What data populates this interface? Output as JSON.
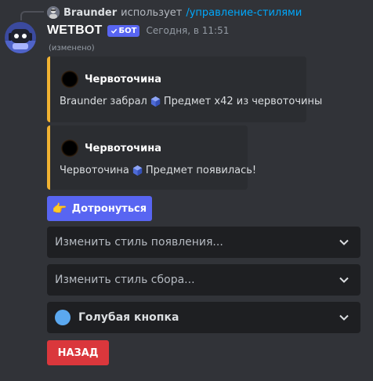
{
  "reply": {
    "author": "Braunder",
    "action": "использует",
    "command": "/управление-стилями"
  },
  "message": {
    "username": "WETBOT",
    "bot_tag": "БОТ",
    "timestamp": "Сегодня, в 11:51",
    "edited": "(изменено)"
  },
  "embeds": [
    {
      "author": "Червоточина",
      "desc_prefix": "Braunder забрал",
      "desc_suffix": "Предмет x42 из червоточины",
      "accent": "#f0b232"
    },
    {
      "author": "Червоточина",
      "desc_prefix": "Червоточина",
      "desc_suffix": "Предмет появилась!",
      "accent": "#f0b232"
    }
  ],
  "buttons": {
    "touch_label": "Дотронуться",
    "touch_icon": "pointing-hand-emoji",
    "back_label": "НАЗАД"
  },
  "selects": [
    {
      "placeholder": "Изменить стиль появления..."
    },
    {
      "placeholder": "Изменить стиль сбора..."
    },
    {
      "value": "Голубая кнопка",
      "color": "#5ba8f0"
    }
  ],
  "colors": {
    "blurple": "#5865f2",
    "danger": "#da373c",
    "link": "#00a8fc",
    "embed_accent": "#f0b232"
  }
}
